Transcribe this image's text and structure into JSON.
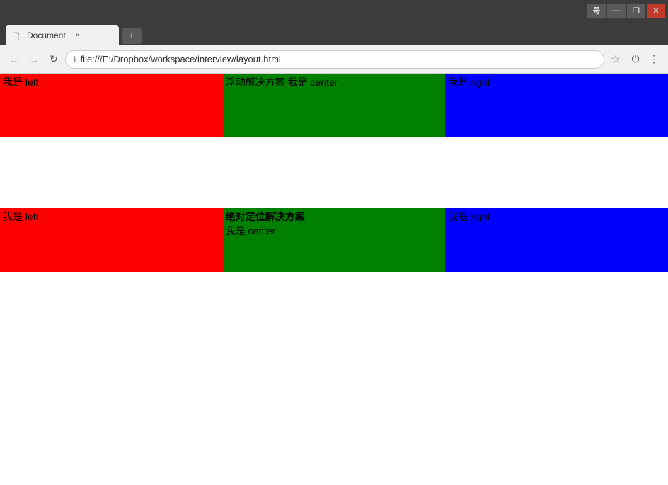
{
  "browser": {
    "tab_title": "Document",
    "address": "file:///E:/Dropbox/workspace/interview/layout.html",
    "new_tab_label": "+",
    "back_label": "←",
    "forward_label": "→",
    "refresh_label": "↻",
    "star_label": "☆",
    "power_label": "⏻",
    "menu_label": "⋮",
    "secure_icon": "ℹ",
    "tab_close": "×",
    "title_bar_minimize": "—",
    "title_bar_restore": "❐",
    "title_bar_close": "✕",
    "title_bar_extra": "号"
  },
  "section1": {
    "left_text": "我是 left",
    "center_label": "浮动解决方案",
    "center_text": "我是 center",
    "right_text": "我是 right"
  },
  "section2": {
    "left_text": "我是 left",
    "center_label": "绝对定位解决方案",
    "center_text": "我是 center",
    "right_text": "我是 right"
  }
}
